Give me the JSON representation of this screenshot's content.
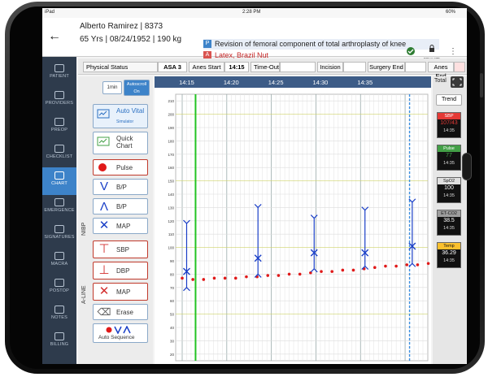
{
  "status_bar": {
    "device": "iPad",
    "time": "2:28 PM",
    "battery": "60%"
  },
  "patient": {
    "name_line": "Alberto Ramirez | 8373",
    "info_line": "65 Yrs | 08/24/1952 | 190 kg",
    "procedure_tag": "P",
    "procedure": "Revision of femoral component of total arthroplasty of knee",
    "allergy_tag": "A",
    "allergies": "Latex, Brazil Nut"
  },
  "header_actions": {
    "finalize_label": "FINALIZE"
  },
  "sidebar": {
    "items": [
      {
        "label": "PATIENT"
      },
      {
        "label": "PROVIDERS"
      },
      {
        "label": "PREOP"
      },
      {
        "label": "CHECKLIST"
      },
      {
        "label": "CHART"
      },
      {
        "label": "EMERGENCE"
      },
      {
        "label": "SIGNATURES"
      },
      {
        "label": "MACRA"
      },
      {
        "label": "POSTOP"
      },
      {
        "label": "NOTES"
      },
      {
        "label": "BILLING"
      }
    ]
  },
  "milestones": {
    "physical_status_label": "Physical Status",
    "physical_status_value": "ASA 3",
    "anes_start_label": "Anes Start",
    "anes_start_value": "14:15",
    "timeout_label": "Time-Out",
    "incision_label": "Incision",
    "surgery_end_label": "Surgery End",
    "anes_end_label": "Anes End"
  },
  "controls": {
    "interval": "1min",
    "autoscroll": "Autoscroll On",
    "auto_vital": "Auto Vital",
    "auto_vital_sub": "Simulator",
    "quick_chart": "Quick Chart",
    "pulse": "Pulse",
    "bp_down": "B/P",
    "bp_up": "B/P",
    "map": "MAP",
    "sbp": "SBP",
    "dbp": "DBP",
    "map2": "MAP",
    "erase": "Erase",
    "auto_sequence": "Auto Sequence",
    "nibp_label": "NIBP",
    "aline_label": "A-LINE"
  },
  "chart_header": {
    "total_label": "Total",
    "trend_label": "Trend"
  },
  "chart_data": {
    "type": "line",
    "x_ticks": [
      "14:15",
      "14:20",
      "14:25",
      "14:30",
      "14:35"
    ],
    "y_ticks": [
      210,
      200,
      190,
      180,
      170,
      160,
      150,
      140,
      130,
      120,
      110,
      100,
      90,
      80,
      70,
      60,
      50,
      40,
      30,
      20
    ],
    "ylim": [
      15,
      215
    ],
    "pulse_series": {
      "name": "Pulse",
      "x_min": [
        0,
        1.2,
        2.4,
        3.6,
        4.8,
        6,
        7.2,
        8.4,
        9.6,
        10.8,
        12,
        13.2,
        14.4,
        15.6,
        16.8,
        18,
        19.2,
        20.4,
        21.6,
        22.8,
        24,
        25.2,
        26.4,
        27.6
      ],
      "values": [
        77,
        76,
        76,
        77,
        77,
        77,
        78,
        78,
        79,
        79,
        80,
        80,
        81,
        82,
        82,
        83,
        83,
        84,
        85,
        86,
        86,
        87,
        87,
        88
      ]
    },
    "nibp": [
      {
        "x_min": 0.5,
        "sbp": 118,
        "dbp": 70,
        "map": 82
      },
      {
        "x_min": 8.5,
        "sbp": 130,
        "dbp": 80,
        "map": 92
      },
      {
        "x_min": 14.8,
        "sbp": 122,
        "dbp": 84,
        "map": 96
      },
      {
        "x_min": 20.5,
        "sbp": 128,
        "dbp": 86,
        "map": 96
      },
      {
        "x_min": 25.8,
        "sbp": 134,
        "dbp": 88,
        "map": 101
      }
    ],
    "anes_start_line_min": 1.5,
    "current_time_line_min": 25.5,
    "grid": true
  },
  "vitals": [
    {
      "label": "SBP",
      "value": "107/43",
      "color": "#e53935",
      "text_dark": false
    },
    {
      "label": "Pulse",
      "value": "77",
      "color": "#43a047",
      "text_dark": false
    },
    {
      "label": "SpO2",
      "value": "100",
      "color": "#e0e0e0",
      "text_dark": true
    },
    {
      "label": "ET-CO2",
      "value": "38.5",
      "color": "#9e9e9e",
      "text_dark": true
    },
    {
      "label": "Temp",
      "value": "36.29",
      "color": "#fbc02d",
      "text_dark": true
    }
  ],
  "vital_times": [
    "14:35",
    "14:35",
    "14:35",
    "14:35",
    "14:35"
  ],
  "colors": {
    "sidebar": "#2e3b4c",
    "active": "#3d83c9",
    "bp_blue": "#1a3fc7",
    "pulse_red": "#e01919"
  }
}
